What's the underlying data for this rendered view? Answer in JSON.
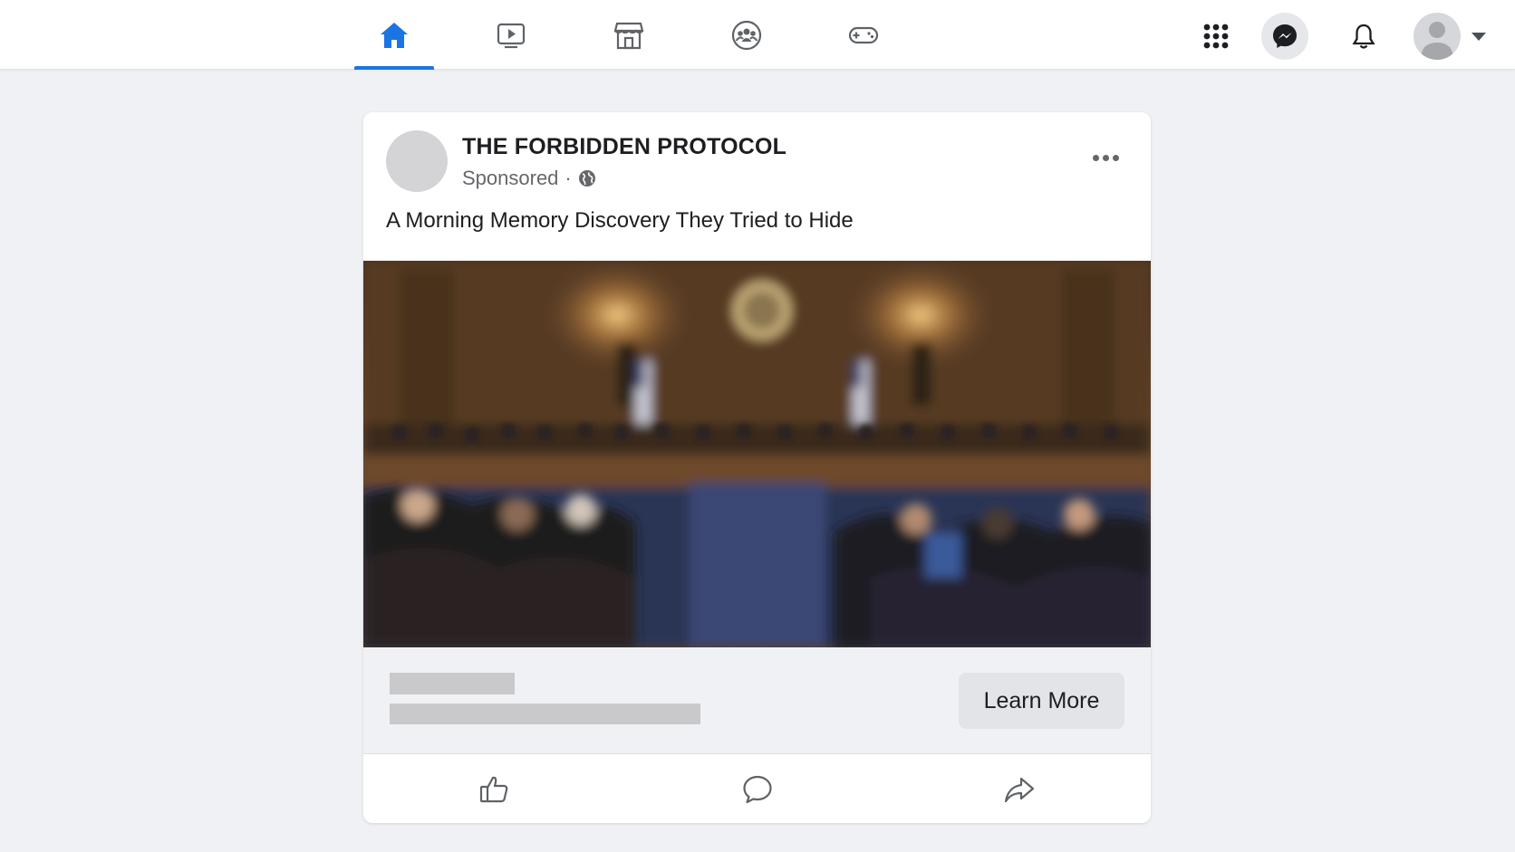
{
  "colors": {
    "accent": "#1b74e4",
    "background": "#f0f1f5",
    "icon": "#4b4f56",
    "text_primary": "#1c1e21",
    "text_secondary": "#65676b"
  },
  "topnav": {
    "tabs": [
      {
        "icon": "home-icon",
        "active": true
      },
      {
        "icon": "watch-video-icon",
        "active": false
      },
      {
        "icon": "marketplace-store-icon",
        "active": false
      },
      {
        "icon": "groups-icon",
        "active": false
      },
      {
        "icon": "gaming-controller-icon",
        "active": false
      }
    ],
    "right_icons": [
      "menu-grid-icon",
      "messenger-icon",
      "notifications-bell-icon",
      "account-avatar-icon",
      "caret-down-icon"
    ]
  },
  "post": {
    "page_name": "THE FORBIDDEN PROTOCOL",
    "sponsored_label": "Sponsored",
    "separator": "·",
    "privacy_icon": "globe-icon",
    "text": "A Morning Memory Discovery They Tried to Hide",
    "image_subject": "hearing-room-photo",
    "cta_label": "Learn More",
    "actions": [
      "like-icon",
      "comment-icon",
      "share-icon"
    ]
  }
}
